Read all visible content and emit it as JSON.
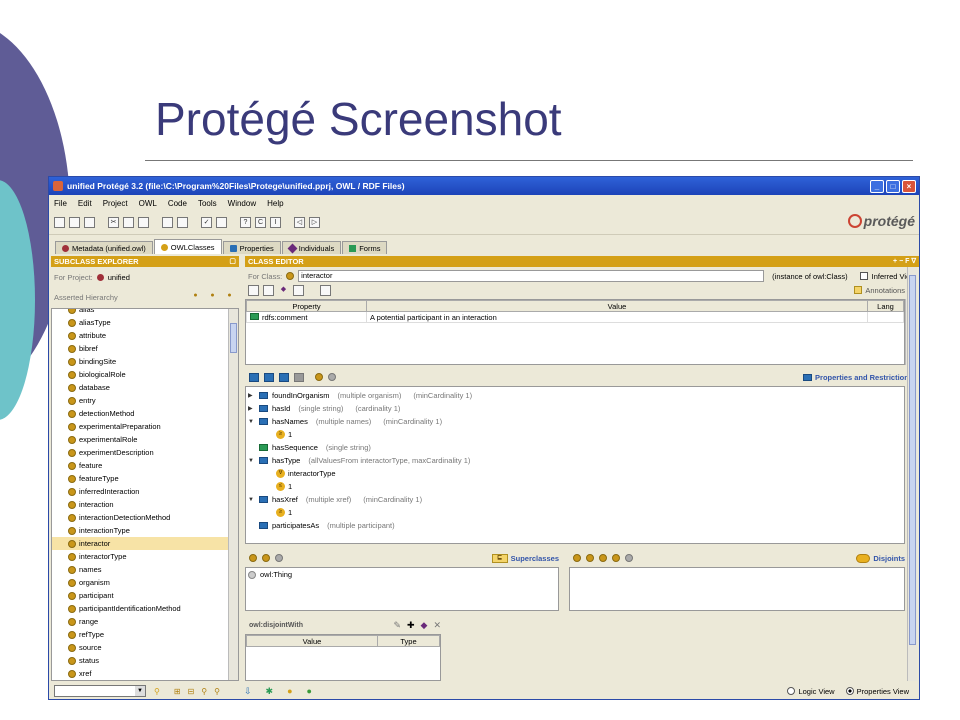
{
  "slide": {
    "title": "Protégé Screenshot"
  },
  "window": {
    "title": "unified  Protégé 3.2     (file:\\C:\\Program%20Files\\Protege\\unified.pprj, OWL / RDF Files)",
    "controls": {
      "minimize": "_",
      "maximize": "□",
      "close": "×"
    }
  },
  "menu": [
    "File",
    "Edit",
    "Project",
    "OWL",
    "Code",
    "Tools",
    "Window",
    "Help"
  ],
  "logo": "protégé",
  "tabs": [
    {
      "label": "Metadata (unified.owl)",
      "color": "#a0303a"
    },
    {
      "label": "OWLClasses",
      "color": "#d4a017"
    },
    {
      "label": "Properties",
      "color": "#2a6fb5"
    },
    {
      "label": "Individuals",
      "color": "#6a2a7a"
    },
    {
      "label": "Forms",
      "color": "#2a9a55"
    }
  ],
  "subclass_explorer": {
    "header": "SUBCLASS EXPLORER",
    "for_project_label": "For Project:",
    "project_name": "unified",
    "hierarchy_label": "Asserted Hierarchy",
    "items": [
      "alias",
      "aliasType",
      "attribute",
      "bibref",
      "bindingSite",
      "biologicalRole",
      "database",
      "entry",
      "detectionMethod",
      "experimentalPreparation",
      "experimentalRole",
      "experimentDescription",
      "feature",
      "featureType",
      "inferredInteraction",
      "interaction",
      "interactionDetectionMethod",
      "interactionType",
      "interactor",
      "interactorType",
      "names",
      "organism",
      "participant",
      "participantIdentificationMethod",
      "range",
      "refType",
      "source",
      "status",
      "xref"
    ],
    "selected": "interactor"
  },
  "class_editor": {
    "header": "CLASS EDITOR",
    "for_class_label": "For Class:",
    "class_name": "interactor",
    "instance_of": "(instance of owl:Class)",
    "inferred_view": "Inferred View",
    "annotations_label": "Annotations",
    "annotation_columns": [
      "Property",
      "Value",
      "Lang"
    ],
    "annotation_rows": [
      {
        "property": "rdfs:comment",
        "value": "A potential participant in an interaction",
        "lang": ""
      }
    ],
    "properties_label": "Properties and Restrictions",
    "properties": [
      {
        "expander": "▶",
        "name": "foundInOrganism",
        "range": "(multiple organism)",
        "restriction": "(minCardinality 1)",
        "kind": "object",
        "children": []
      },
      {
        "expander": "▶",
        "name": "hasId",
        "range": "(single string)",
        "restriction": "(cardinality 1)",
        "kind": "object",
        "children": []
      },
      {
        "expander": "▼",
        "name": "hasNames",
        "range": "(multiple names)",
        "restriction": "(minCardinality 1)",
        "kind": "object",
        "children": [
          {
            "badge": "≥",
            "text": "1"
          }
        ]
      },
      {
        "expander": "",
        "name": "hasSequence",
        "range": "(single string)",
        "restriction": "",
        "kind": "datatype",
        "children": []
      },
      {
        "expander": "▼",
        "name": "hasType",
        "range": "(allValuesFrom interactorType, maxCardinality 1)",
        "restriction": "",
        "kind": "object",
        "children": [
          {
            "badge": "∀",
            "text": "interactorType"
          },
          {
            "badge": "≤",
            "text": "1"
          }
        ]
      },
      {
        "expander": "▼",
        "name": "hasXref",
        "range": "(multiple xref)",
        "restriction": "(minCardinality 1)",
        "kind": "object",
        "children": [
          {
            "badge": "≥",
            "text": "1"
          }
        ]
      },
      {
        "expander": "",
        "name": "participatesAs",
        "range": "(multiple participant)",
        "restriction": "",
        "kind": "object",
        "children": []
      }
    ],
    "superclasses_label": "Superclasses",
    "superclasses": [
      "owl:Thing"
    ],
    "disjoints_label": "Disjoints",
    "disjoint_with_label": "owl:disjointWith",
    "disjoint_columns": [
      "Value",
      "Type"
    ]
  },
  "footer": {
    "logic_view": "Logic View",
    "properties_view": "Properties View",
    "selected_view": "Properties View"
  }
}
